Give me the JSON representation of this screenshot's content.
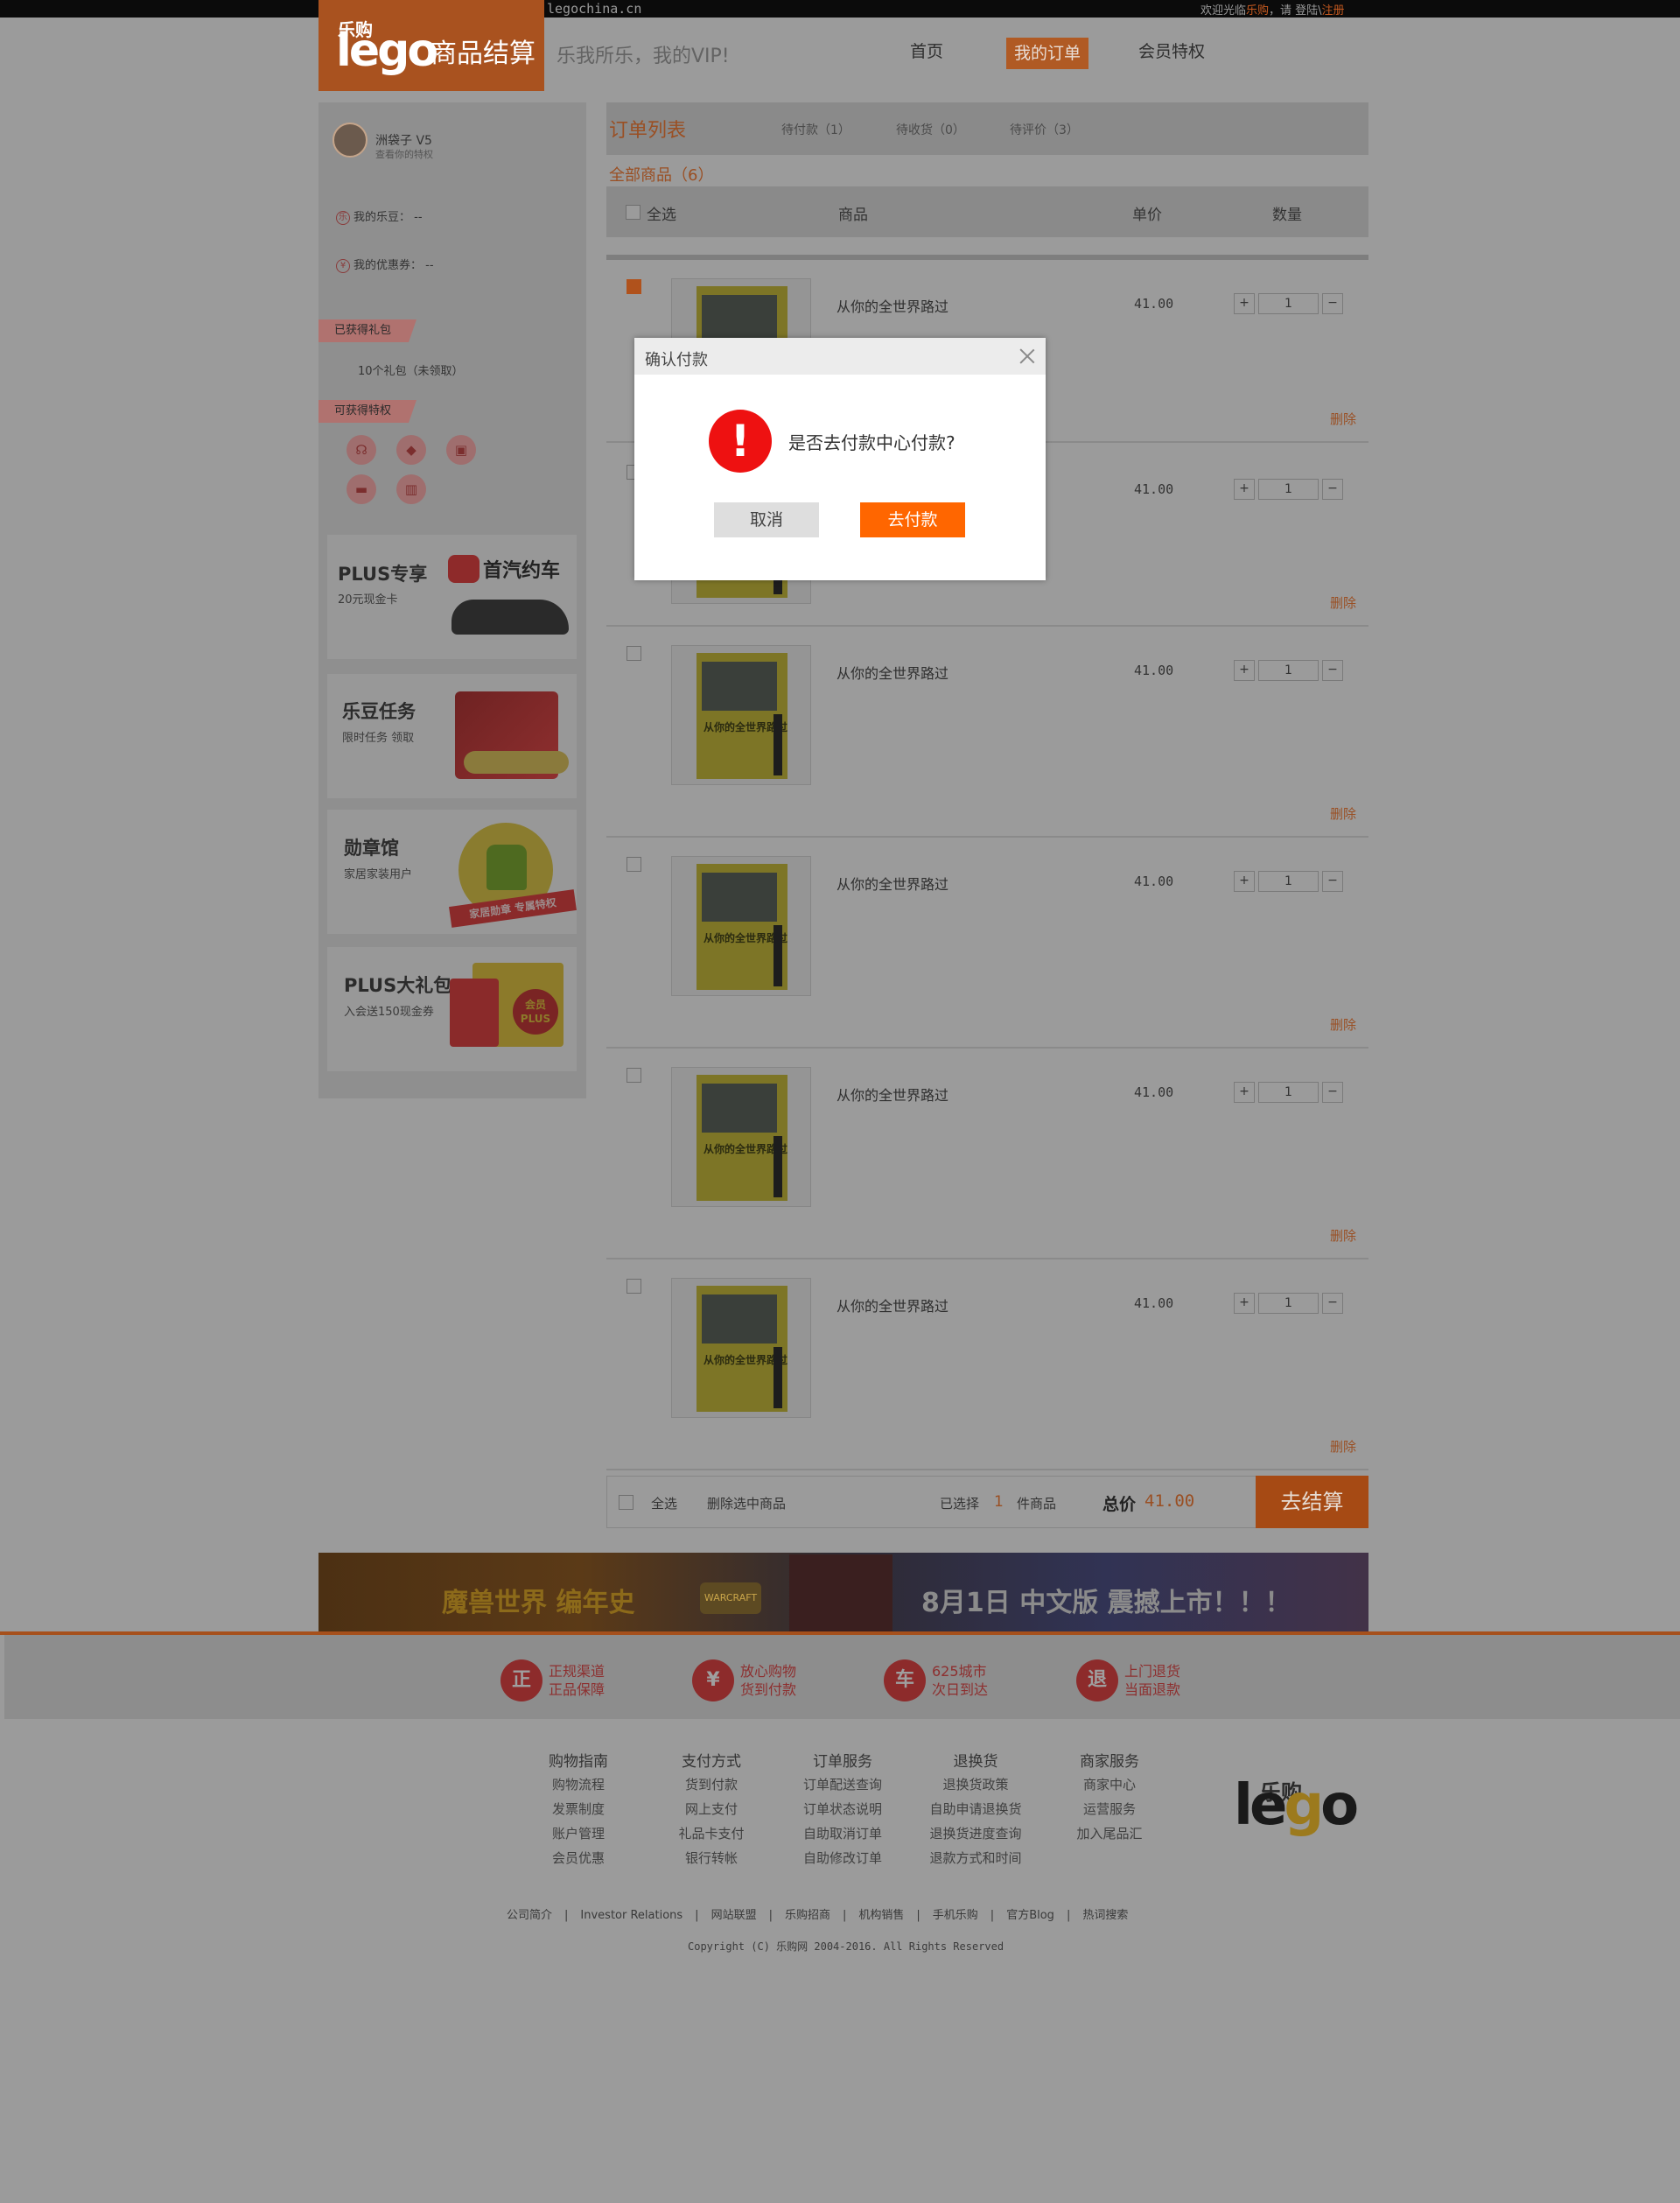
{
  "topbar": {
    "url": "legochina.cn",
    "welcome_pre": "欢迎光临",
    "welcome_brand": "乐购",
    "welcome_mid": "，请 登陆\\",
    "welcome_register": "注册"
  },
  "header": {
    "logo_small": "乐购",
    "logo_text": "lego",
    "logo_title": "商品结算",
    "slogan": "乐我所乐，我的VIP!",
    "nav": [
      "首页",
      "我的订单",
      "会员特权"
    ]
  },
  "sidebar": {
    "username": "洲袋子  V5",
    "user_hint": "查看你的特权",
    "ledou": "我的乐豆： --",
    "coupon": "我的优惠券： --",
    "gift_tag": "已获得礼包",
    "gift_text": "10个礼包（未领取）",
    "privilege_tag": "可获得特权",
    "privilege_icons": [
      "headset-icon",
      "tag-icon",
      "gift-icon",
      "truck-icon",
      "cake-icon"
    ],
    "promos": [
      {
        "title": "PLUS专享",
        "sub": "20元现金卡",
        "brand": "首汽约车"
      },
      {
        "title": "乐豆任务",
        "sub": "限时任务  领取"
      },
      {
        "title": "勋章馆",
        "sub": "家居家装用户",
        "ribbon": "家居勋章 专属特权"
      },
      {
        "title": "PLUS大礼包",
        "sub": "入会送150现金券",
        "badge": "会员PLUS"
      }
    ]
  },
  "main": {
    "tab_title": "订单列表",
    "tabs": [
      "待付款（1）",
      "待收货（0）",
      "待评价（3）"
    ],
    "all_goods": "全部商品（6）",
    "headers": {
      "select_all": "全选",
      "product": "商品",
      "unit_price": "单价",
      "quantity": "数量"
    },
    "book_title": "从你的全世界路过",
    "items": [
      {
        "name": "从你的全世界路过",
        "price": "41.00",
        "qty": "1",
        "delete": "删除",
        "checked": true
      },
      {
        "name": "从你的全世界路过",
        "price": "41.00",
        "qty": "1",
        "delete": "删除",
        "checked": false
      },
      {
        "name": "从你的全世界路过",
        "price": "41.00",
        "qty": "1",
        "delete": "删除",
        "checked": false
      },
      {
        "name": "从你的全世界路过",
        "price": "41.00",
        "qty": "1",
        "delete": "删除",
        "checked": false
      },
      {
        "name": "从你的全世界路过",
        "price": "41.00",
        "qty": "1",
        "delete": "删除",
        "checked": false
      },
      {
        "name": "从你的全世界路过",
        "price": "41.00",
        "qty": "1",
        "delete": "删除",
        "checked": false
      }
    ],
    "qty_plus": "+",
    "qty_minus": "−",
    "summary": {
      "select_all": "全选",
      "delete_selected": "删除选中商品",
      "selected_pre": "已选择",
      "selected_count": "1",
      "selected_post": "件商品",
      "total_label": "总价",
      "total_value": "41.00",
      "checkout": "去结算"
    }
  },
  "banner": {
    "left_text": "魔兽世界 编年史",
    "logo_text": "WARCRAFT",
    "right_text": "8月1日 中文版 震撼上市！！！"
  },
  "guarantees": [
    {
      "icon": "正",
      "line1": "正规渠道",
      "line2": "正品保障"
    },
    {
      "icon": "¥",
      "line1": "放心购物",
      "line2": "货到付款"
    },
    {
      "icon": "车",
      "line1": "625城市",
      "line2": "次日到达"
    },
    {
      "icon": "退",
      "line1": "上门退货",
      "line2": "当面退款"
    }
  ],
  "footer": {
    "columns": [
      {
        "title": "购物指南",
        "items": [
          "购物流程",
          "发票制度",
          "账户管理",
          "会员优惠"
        ]
      },
      {
        "title": "支付方式",
        "items": [
          "货到付款",
          "网上支付",
          "礼品卡支付",
          "银行转帐"
        ]
      },
      {
        "title": "订单服务",
        "items": [
          "订单配送查询",
          "订单状态说明",
          "自助取消订单",
          "自助修改订单"
        ]
      },
      {
        "title": "退换货",
        "items": [
          "退换货政策",
          "自助申请退换货",
          "退换货进度查询",
          "退款方式和时间"
        ]
      },
      {
        "title": "商家服务",
        "items": [
          "商家中心",
          "运营服务",
          "加入尾品汇"
        ]
      }
    ],
    "links": [
      "公司简介",
      "Investor Relations",
      "网站联盟",
      "乐购招商",
      "机构销售",
      "手机乐购",
      "官方Blog",
      "热词搜索"
    ],
    "copyright": "Copyright (C) 乐购网 2004-2016. All Rights Reserved",
    "logo_small": "乐购",
    "logo_le": "le",
    "logo_g": "g",
    "logo_o": "o"
  },
  "modal": {
    "title": "确认付款",
    "icon": "!",
    "message": "是否去付款中心付款?",
    "cancel": "取消",
    "confirm": "去付款"
  }
}
